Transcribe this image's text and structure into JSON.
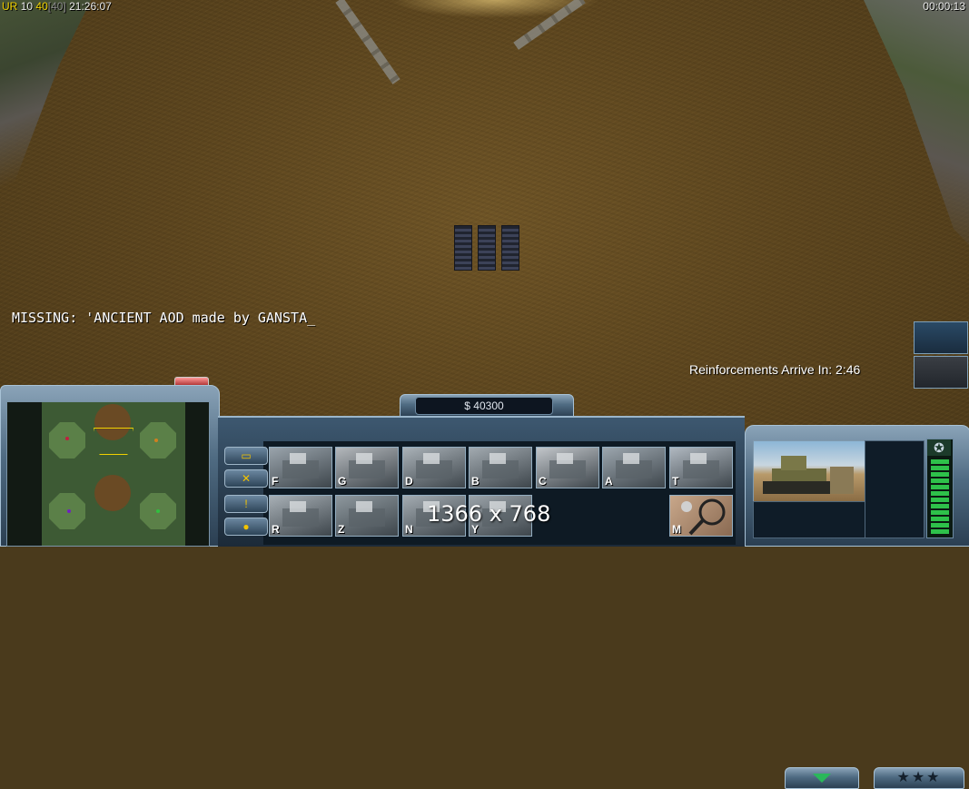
{
  "hud": {
    "stats_a": "UR",
    "stats_b": "10",
    "stats_c": "40",
    "stats_d": "[40]",
    "clock": "21:26:07",
    "timer": "00:00:13"
  },
  "console_line": "MISSING: 'ANCIENT AOD made by GANSTA_",
  "reinforcements_text": "Reinforcements Arrive In: 2:46",
  "money": "$ 40300",
  "build_buttons": [
    {
      "key": "F",
      "icon": "factory-building-icon",
      "color": "#9aa4ac"
    },
    {
      "key": "G",
      "icon": "barracks-flag-icon",
      "color": "#b4b8bc"
    },
    {
      "key": "D",
      "icon": "command-center-icon",
      "color": "#aab2b8"
    },
    {
      "key": "B",
      "icon": "bunker-icon",
      "color": "#a2aab0"
    },
    {
      "key": "C",
      "icon": "artillery-cannon-icon",
      "color": "#c2c6ca"
    },
    {
      "key": "A",
      "icon": "airfield-icon",
      "color": "#9ca6ae"
    },
    {
      "key": "T",
      "icon": "tower-building-icon",
      "color": "#b0b8c0"
    },
    {
      "key": "R",
      "icon": "refinery-icon",
      "color": "#a8b0b6"
    },
    {
      "key": "Z",
      "icon": "supply-zone-icon",
      "color": "#8e989e"
    },
    {
      "key": "N",
      "icon": "nuclear-plant-icon",
      "color": "#a4acb2"
    },
    {
      "key": "Y",
      "icon": "yard-icon",
      "color": "#9aa2a8"
    }
  ],
  "special_button": {
    "key": "M",
    "icon": "mine-detector-icon"
  },
  "resolution_watermark": "1366 x 768",
  "stars_label": "★★★",
  "colors": {
    "accent_yellow": "#f0d000",
    "power_green": "#2ec14a",
    "grid_glow": "#c8b0ff"
  }
}
